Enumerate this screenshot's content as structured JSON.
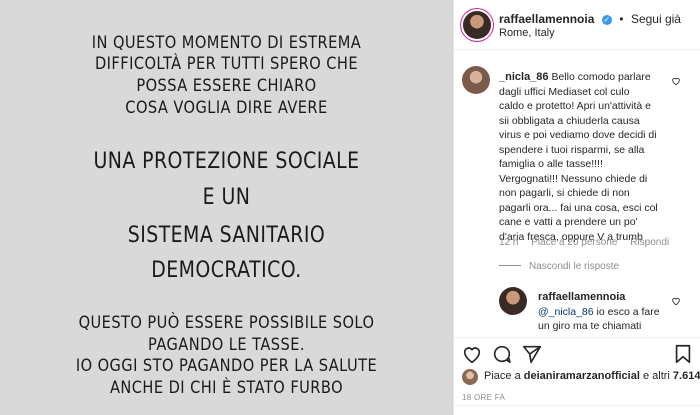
{
  "post": {
    "lines": [
      "IN QUESTO MOMENTO DI ESTREMA",
      "DIFFICOLTÀ PER TUTTI SPERO CHE",
      "POSSA ESSERE CHIARO",
      "COSA VOGLIA DIRE AVERE",
      "UNA PROTEZIONE SOCIALE",
      "E UN",
      "SISTEMA SANITARIO",
      "DEMOCRATICO.",
      "QUESTO PUÒ ESSERE POSSIBILE SOLO",
      "PAGANDO LE TASSE.",
      "IO OGGI STO PAGANDO PER LA SALUTE",
      "ANCHE DI CHI È STATO FURBO"
    ]
  },
  "header": {
    "username": "raffaellamennoia",
    "verified_mark": "✓",
    "separator": "•",
    "follow_label": "Segui già",
    "location": "Rome, Italy"
  },
  "comment": {
    "username": "_nicla_86",
    "lines": [
      "Bello comodo parlare",
      "dagli uffici Mediaset col culo",
      "caldo e protetto! Apri un'attività e",
      "sii obbligata a chiuderla causa",
      "virus e poi vediamo dove decidi di",
      "spendere i tuoi risparmi, se alla",
      "famiglia o alle tasse!!!!",
      "Vergognati!!! Nessuno chiede di",
      "non pagarli, si chiede di non",
      "pagarli ora... fai una cosa, esci col",
      "cane e vatti a prendere un po'",
      "d'aria fresca, oppure V a trumb"
    ],
    "age": "12 h",
    "likes": "Piace a 20 persone",
    "reply_label": "Rispondi",
    "hide_replies": "Nascondi le risposte"
  },
  "reply": {
    "username": "raffaellamennoia",
    "mention": "@_nicla_86",
    "lines": [
      "io esco a fare",
      "un giro ma te chiamati"
    ]
  },
  "likes_bar": {
    "prefix": "Piace a ",
    "user": "deianiramarzanofficial",
    "suffix": " e altri ",
    "count": "7.614"
  },
  "timestamp": "18 ORE FA",
  "colors": {
    "highlight": "#f7f35a",
    "verified": "#3897f0",
    "link": "#00376b"
  }
}
